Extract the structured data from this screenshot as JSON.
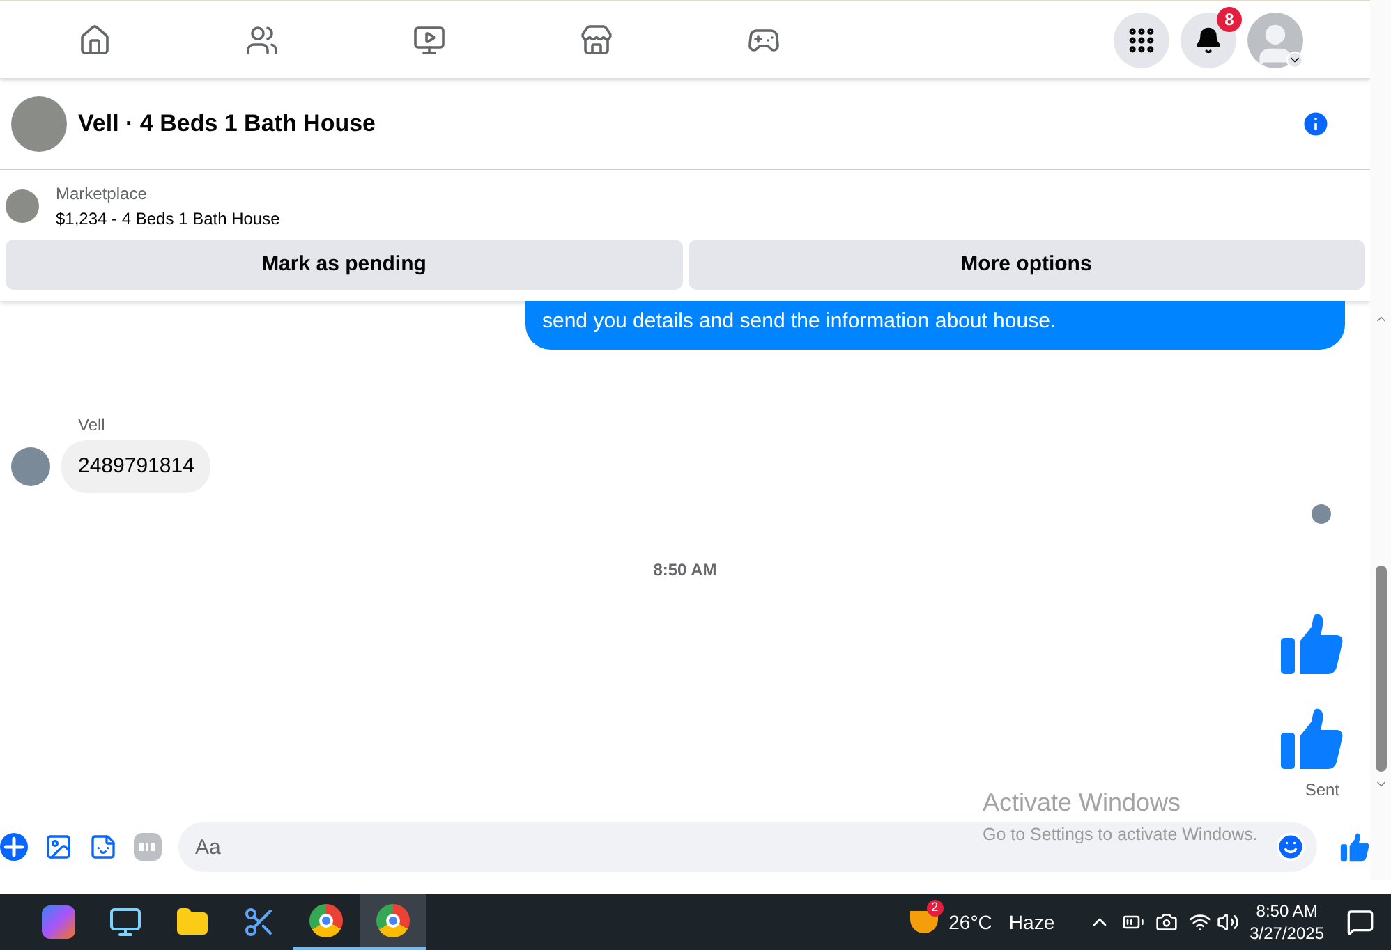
{
  "nav": {
    "notification_count": "8"
  },
  "header": {
    "title": "Vell · 4 Beds 1 Bath House"
  },
  "listing": {
    "source": "Marketplace",
    "title": "$1,234 - 4 Beds 1 Bath House",
    "buttons": [
      "Mark as pending",
      "More options"
    ]
  },
  "messages": [
    {
      "kind": "outgoing",
      "text": "send you details and send the information about house."
    },
    {
      "kind": "incoming",
      "sender": "Vell",
      "text": "2489791814"
    },
    {
      "kind": "seen"
    },
    {
      "kind": "time",
      "text": "8:50 AM"
    },
    {
      "kind": "like"
    },
    {
      "kind": "like",
      "status": "Sent"
    }
  ],
  "composer": {
    "placeholder": "Aa"
  },
  "os_notice": {
    "title": "Activate Windows",
    "text": "Go to Settings to activate Windows."
  },
  "taskbar": {
    "apps": [
      {
        "kind": "copilot",
        "running": false,
        "selected": false
      },
      {
        "kind": "remote",
        "running": false,
        "selected": false
      },
      {
        "kind": "folder",
        "running": false,
        "selected": false
      },
      {
        "kind": "snip",
        "running": false,
        "selected": false
      },
      {
        "kind": "chrome",
        "running": true,
        "selected": false
      },
      {
        "kind": "chrome",
        "running": true,
        "selected": true
      }
    ],
    "weather_badge": "2",
    "temperature": "26°C",
    "condition": "Haze",
    "time": "8:50 AM",
    "date": "3/27/2025"
  }
}
